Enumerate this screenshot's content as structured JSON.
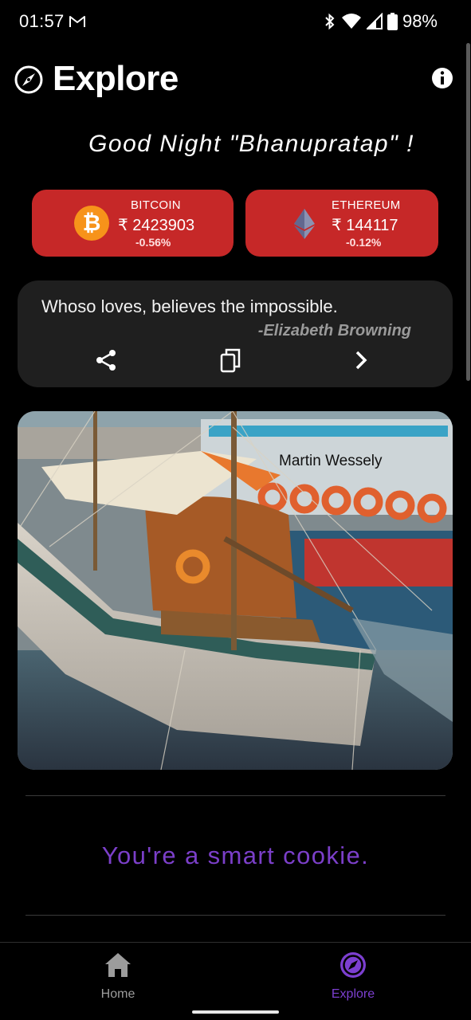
{
  "status_bar": {
    "time": "01:57",
    "battery": "98%",
    "icons": [
      "gmail-icon",
      "bluetooth-icon",
      "wifi-icon",
      "signal-icon",
      "battery-icon"
    ]
  },
  "header": {
    "title": "Explore",
    "left_icon": "compass-icon",
    "right_icon": "info-icon"
  },
  "greeting": "Good Night \"Bhanupratap\" !",
  "crypto": [
    {
      "name": "BITCOIN",
      "price": "₹ 2423903",
      "change": "-0.56%",
      "icon": "bitcoin-icon"
    },
    {
      "name": "ETHEREUM",
      "price": "₹ 144117",
      "change": "-0.12%",
      "icon": "ethereum-icon"
    }
  ],
  "quote": {
    "text": "Whoso loves, believes the impossible.",
    "author": "-Elizabeth Browning",
    "actions": [
      "share-icon",
      "copy-icon",
      "next-icon"
    ]
  },
  "photo": {
    "credit": "Martin Wessely"
  },
  "compliment": "You're a smart cookie.",
  "nav": {
    "items": [
      {
        "label": "Home",
        "icon": "home-icon",
        "active": false
      },
      {
        "label": "Explore",
        "icon": "compass-icon",
        "active": true
      }
    ]
  },
  "colors": {
    "background": "#000000",
    "crypto_card": "#c62828",
    "quote_card": "#1f1f1f",
    "accent_purple": "#7c3fd0",
    "bitcoin_orange": "#f7931a"
  }
}
